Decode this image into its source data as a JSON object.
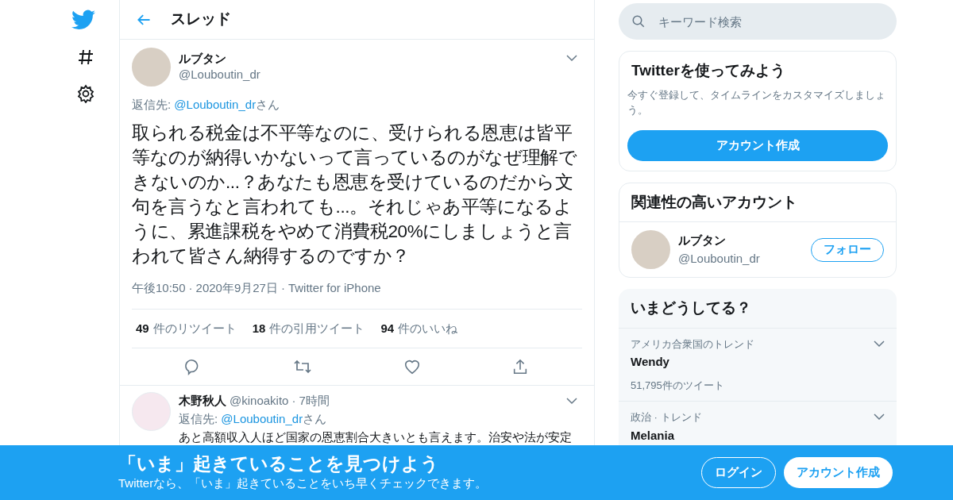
{
  "header": {
    "title": "スレッド"
  },
  "tweet": {
    "name": "ルブタン",
    "handle": "@Louboutin_dr",
    "reply_prefix": "返信先: ",
    "reply_to": "@Louboutin_dr",
    "reply_suffix": "さん",
    "text": "取られる税金は不平等なのに、受けられる恩恵は皆平等なのが納得いかないって言っているのがなぜ理解できないのか...？あなたも恩恵を受けているのだから文句を言うなと言われても...。それじゃあ平等になるように、累進課税をやめて消費税20%にしましょうと言われて皆さん納得するのですか？",
    "time": "午後10:50",
    "separator": "·",
    "date": "2020年9月27日",
    "source": "Twitter for iPhone",
    "stats": [
      {
        "count": "49",
        "label": "件のリツイート"
      },
      {
        "count": "18",
        "label": "件の引用ツイート"
      },
      {
        "count": "94",
        "label": "件のいいね"
      }
    ]
  },
  "reply": {
    "name": "木野秋人",
    "handle": "@kinoakito",
    "separator": "·",
    "time": "7時間",
    "reply_prefix": "返信先: ",
    "reply_to": "@Louboutin_dr",
    "reply_suffix": "さん",
    "text": "あと高額収入人ほど国家の恩恵割合大きいとも言えます。治安や法が安定"
  },
  "search": {
    "placeholder": "キーワード検索"
  },
  "signup": {
    "title": "Twitterを使ってみよう",
    "text": "今すぐ登録して、タイムラインをカスタマイズしましょう。",
    "button": "アカウント作成"
  },
  "related": {
    "title": "関連性の高いアカウント",
    "name": "ルブタン",
    "handle": "@Louboutin_dr",
    "button": "フォロー"
  },
  "trends": {
    "title": "いまどうしてる？",
    "items": [
      {
        "context": "アメリカ合衆国のトレンド",
        "name": "Wendy",
        "count": "51,795件のツイート"
      },
      {
        "context": "政治 · トレンド",
        "name": "Melania"
      }
    ]
  },
  "banner": {
    "title": "「いま」起きていることを見つけよう",
    "text": "Twitterなら、「いま」起きていることをいち早くチェックできます。",
    "buttons": [
      {
        "kind": "outline",
        "label": "ログイン"
      },
      {
        "kind": "solid",
        "label": "アカウント作成"
      }
    ]
  }
}
